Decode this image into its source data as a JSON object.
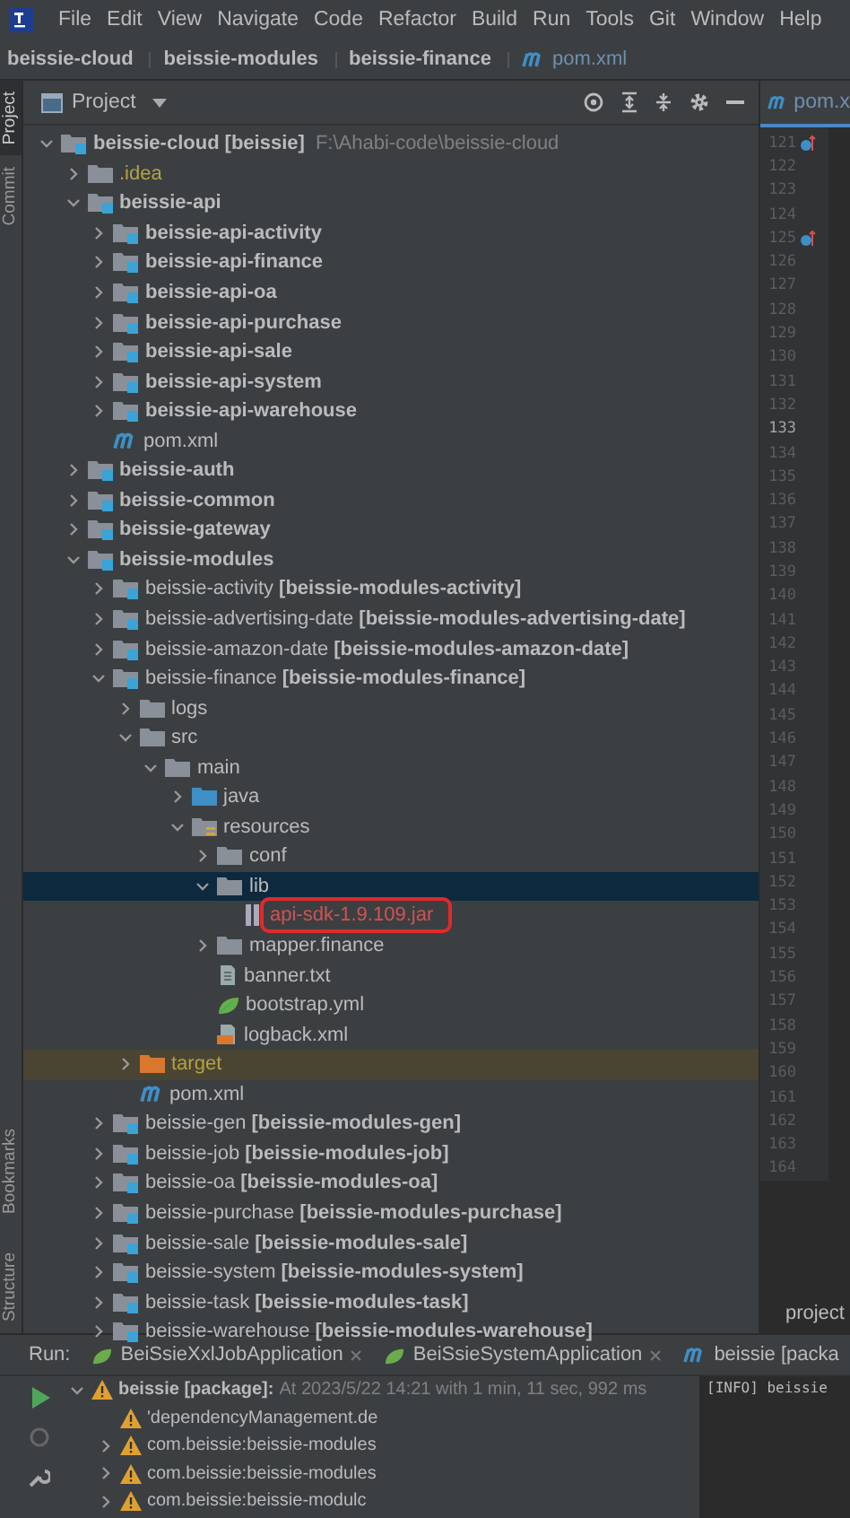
{
  "menu": [
    "File",
    "Edit",
    "View",
    "Navigate",
    "Code",
    "Refactor",
    "Build",
    "Run",
    "Tools",
    "Git",
    "Window",
    "Help"
  ],
  "breadcrumb": [
    {
      "label": "beissie-cloud",
      "kind": "module"
    },
    {
      "label": "beissie-modules",
      "kind": "module"
    },
    {
      "label": "beissie-finance",
      "kind": "module"
    },
    {
      "label": "pom.xml",
      "kind": "maven"
    }
  ],
  "side_tabs": [
    {
      "label": "Project",
      "selected": true
    },
    {
      "label": "Commit",
      "selected": false
    },
    {
      "label": "Bookmarks",
      "selected": false
    },
    {
      "label": "Structure",
      "selected": false
    }
  ],
  "project_panel": {
    "title": "Project"
  },
  "tree": [
    {
      "label": "beissie-cloud",
      "suffix": "[beissie]",
      "path": "F:\\Ahabi-code\\beissie-cloud",
      "kind": "module",
      "bold": true,
      "expanded": true,
      "selected": false,
      "children": [
        {
          "label": ".idea",
          "kind": "folder",
          "color": "#b3a245",
          "expanded": false,
          "selected": false
        },
        {
          "label": "beissie-api",
          "kind": "module",
          "bold": true,
          "expanded": true,
          "selected": false,
          "children": [
            {
              "label": "beissie-api-activity",
              "kind": "module",
              "bold": true,
              "expanded": false,
              "selected": false
            },
            {
              "label": "beissie-api-finance",
              "kind": "module",
              "bold": true,
              "expanded": false,
              "selected": false
            },
            {
              "label": "beissie-api-oa",
              "kind": "module",
              "bold": true,
              "expanded": false,
              "selected": false
            },
            {
              "label": "beissie-api-purchase",
              "kind": "module",
              "bold": true,
              "expanded": false,
              "selected": false
            },
            {
              "label": "beissie-api-sale",
              "kind": "module",
              "bold": true,
              "expanded": false,
              "selected": false
            },
            {
              "label": "beissie-api-system",
              "kind": "module",
              "bold": true,
              "expanded": false,
              "selected": false
            },
            {
              "label": "beissie-api-warehouse",
              "kind": "module",
              "bold": true,
              "expanded": false,
              "selected": false
            },
            {
              "label": "pom.xml",
              "kind": "maven",
              "selected": false
            }
          ]
        },
        {
          "label": "beissie-auth",
          "kind": "module",
          "bold": true,
          "expanded": false,
          "selected": false
        },
        {
          "label": "beissie-common",
          "kind": "module",
          "bold": true,
          "expanded": false,
          "selected": false
        },
        {
          "label": "beissie-gateway",
          "kind": "module",
          "bold": true,
          "expanded": false,
          "selected": false
        },
        {
          "label": "beissie-modules",
          "kind": "module",
          "bold": true,
          "expanded": true,
          "selected": false,
          "children": [
            {
              "label": "beissie-activity",
              "suffix": "[beissie-modules-activity]",
              "kind": "module",
              "bold": false,
              "expanded": false,
              "selected": false
            },
            {
              "label": "beissie-advertising-date",
              "suffix": "[beissie-modules-advertising-date]",
              "kind": "module",
              "bold": false,
              "expanded": false,
              "selected": false
            },
            {
              "label": "beissie-amazon-date",
              "suffix": "[beissie-modules-amazon-date]",
              "kind": "module",
              "bold": false,
              "expanded": false,
              "selected": false
            },
            {
              "label": "beissie-finance",
              "suffix": "[beissie-modules-finance]",
              "kind": "module",
              "bold": false,
              "expanded": true,
              "selected": false,
              "children": [
                {
                  "label": "logs",
                  "kind": "folder",
                  "expanded": false,
                  "selected": false
                },
                {
                  "label": "src",
                  "kind": "folder",
                  "expanded": true,
                  "selected": false,
                  "children": [
                    {
                      "label": "main",
                      "kind": "folder",
                      "expanded": true,
                      "selected": false,
                      "children": [
                        {
                          "label": "java",
                          "kind": "source-folder",
                          "expanded": false,
                          "selected": false
                        },
                        {
                          "label": "resources",
                          "kind": "resources-folder",
                          "expanded": true,
                          "selected": false,
                          "children": [
                            {
                              "label": "conf",
                              "kind": "folder",
                              "expanded": false,
                              "selected": false
                            },
                            {
                              "label": "lib",
                              "kind": "folder",
                              "expanded": true,
                              "selected": true,
                              "children": [
                                {
                                  "label": "api-sdk-1.9.109.jar",
                                  "kind": "jar",
                                  "color": "#d25252",
                                  "annotated": true,
                                  "selected": false
                                }
                              ]
                            },
                            {
                              "label": "mapper.finance",
                              "kind": "folder",
                              "expanded": false,
                              "selected": false
                            },
                            {
                              "label": "banner.txt",
                              "kind": "text-file",
                              "selected": false
                            },
                            {
                              "label": "bootstrap.yml",
                              "kind": "yml-file",
                              "selected": false
                            },
                            {
                              "label": "logback.xml",
                              "kind": "xml-file",
                              "selected": false
                            }
                          ]
                        }
                      ]
                    }
                  ]
                },
                {
                  "label": "target",
                  "kind": "excluded-folder",
                  "color": "#b3a245",
                  "expanded": false,
                  "selected": false
                },
                {
                  "label": "pom.xml",
                  "kind": "maven",
                  "selected": false
                }
              ]
            },
            {
              "label": "beissie-gen",
              "suffix": "[beissie-modules-gen]",
              "kind": "module",
              "bold": false,
              "expanded": false,
              "selected": false
            },
            {
              "label": "beissie-job",
              "suffix": "[beissie-modules-job]",
              "kind": "module",
              "bold": false,
              "expanded": false,
              "selected": false
            },
            {
              "label": "beissie-oa",
              "suffix": "[beissie-modules-oa]",
              "kind": "module",
              "bold": false,
              "expanded": false,
              "selected": false
            },
            {
              "label": "beissie-purchase",
              "suffix": "[beissie-modules-purchase]",
              "kind": "module",
              "bold": false,
              "expanded": false,
              "selected": false
            },
            {
              "label": "beissie-sale",
              "suffix": "[beissie-modules-sale]",
              "kind": "module",
              "bold": false,
              "expanded": false,
              "selected": false
            },
            {
              "label": "beissie-system",
              "suffix": "[beissie-modules-system]",
              "kind": "module",
              "bold": false,
              "expanded": false,
              "selected": false
            },
            {
              "label": "beissie-task",
              "suffix": "[beissie-modules-task]",
              "kind": "module",
              "bold": false,
              "expanded": false,
              "selected": false
            },
            {
              "label": "beissie-warehouse",
              "suffix": "[beissie-modules-warehouse]",
              "kind": "module",
              "bold": false,
              "expanded": false,
              "selected": false
            }
          ]
        }
      ]
    }
  ],
  "editor": {
    "tab": "pom.x",
    "lines": [
      {
        "number": "121",
        "current": false,
        "marker": true
      },
      {
        "number": "122",
        "current": false,
        "marker": false
      },
      {
        "number": "123",
        "current": false,
        "marker": false
      },
      {
        "number": "124",
        "current": false,
        "marker": false
      },
      {
        "number": "125",
        "current": false,
        "marker": true
      },
      {
        "number": "126",
        "current": false,
        "marker": false
      },
      {
        "number": "127",
        "current": false,
        "marker": false
      },
      {
        "number": "128",
        "current": false,
        "marker": false
      },
      {
        "number": "129",
        "current": false,
        "marker": false
      },
      {
        "number": "130",
        "current": false,
        "marker": false
      },
      {
        "number": "131",
        "current": false,
        "marker": false
      },
      {
        "number": "132",
        "current": false,
        "marker": false
      },
      {
        "number": "133",
        "current": true,
        "marker": false
      },
      {
        "number": "134",
        "current": false,
        "marker": false
      },
      {
        "number": "135",
        "current": false,
        "marker": false
      },
      {
        "number": "136",
        "current": false,
        "marker": false
      },
      {
        "number": "137",
        "current": false,
        "marker": false
      },
      {
        "number": "138",
        "current": false,
        "marker": false
      },
      {
        "number": "139",
        "current": false,
        "marker": false
      },
      {
        "number": "140",
        "current": false,
        "marker": false
      },
      {
        "number": "141",
        "current": false,
        "marker": false
      },
      {
        "number": "142",
        "current": false,
        "marker": false
      },
      {
        "number": "143",
        "current": false,
        "marker": false
      },
      {
        "number": "144",
        "current": false,
        "marker": false
      },
      {
        "number": "145",
        "current": false,
        "marker": false
      },
      {
        "number": "146",
        "current": false,
        "marker": false
      },
      {
        "number": "147",
        "current": false,
        "marker": false
      },
      {
        "number": "148",
        "current": false,
        "marker": false
      },
      {
        "number": "149",
        "current": false,
        "marker": false
      },
      {
        "number": "150",
        "current": false,
        "marker": false
      },
      {
        "number": "151",
        "current": false,
        "marker": false
      },
      {
        "number": "152",
        "current": false,
        "marker": false
      },
      {
        "number": "153",
        "current": false,
        "marker": false
      },
      {
        "number": "154",
        "current": false,
        "marker": false
      },
      {
        "number": "155",
        "current": false,
        "marker": false
      },
      {
        "number": "156",
        "current": false,
        "marker": false
      },
      {
        "number": "157",
        "current": false,
        "marker": false
      },
      {
        "number": "158",
        "current": false,
        "marker": false
      },
      {
        "number": "159",
        "current": false,
        "marker": false
      },
      {
        "number": "160",
        "current": false,
        "marker": false
      },
      {
        "number": "161",
        "current": false,
        "marker": false
      },
      {
        "number": "162",
        "current": false,
        "marker": false
      },
      {
        "number": "163",
        "current": false,
        "marker": false
      },
      {
        "number": "164",
        "current": false,
        "marker": false
      }
    ],
    "breadcrumb": "project"
  },
  "run_panel": {
    "label": "Run:",
    "tabs": [
      {
        "label": "BeiSsieXxlJobApplication",
        "kind": "spring",
        "selected": false
      },
      {
        "label": "BeiSsieSystemApplication",
        "kind": "spring",
        "selected": false
      },
      {
        "label": "beissie [packa",
        "kind": "maven",
        "selected": true
      }
    ],
    "rows": [
      {
        "label": "beissie [package]:",
        "detail": "At 2023/5/22 14:21 with 1 min, 11 sec, 992 ms",
        "expanded": true,
        "children": [
          {
            "label": "'dependencyManagement.de"
          },
          {
            "label": "com.beissie:beissie-modules",
            "expanded": false
          },
          {
            "label": "com.beissie:beissie-modules",
            "expanded": false
          },
          {
            "label": "com.beissie:beissie-modulc",
            "expanded": false
          }
        ]
      }
    ],
    "console": [
      "[INFO] beissie"
    ]
  }
}
